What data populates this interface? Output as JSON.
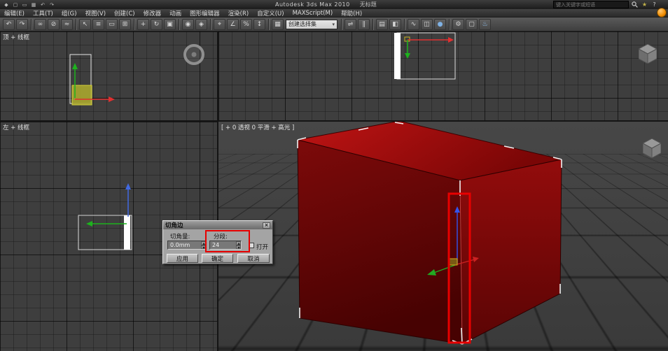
{
  "colors": {
    "box_top": "#bf1414",
    "box_front": "#7d0a0a",
    "box_right": "#930c0c",
    "annotation_red": "#e60000",
    "viewport_bg": "#3e3e3e",
    "infocenter_orb": "#f08c00"
  },
  "titlebar": {
    "app_title": "Autodesk 3ds Max 2010",
    "doc_title": "无标题",
    "search_placeholder": "键入关键字或短语",
    "icons": {
      "star": "★",
      "help": "?"
    },
    "qat": [
      {
        "name": "app-icon",
        "glyph": "◆"
      },
      {
        "name": "new-scene-icon",
        "glyph": "▢"
      },
      {
        "name": "open-file-icon",
        "glyph": "▭"
      },
      {
        "name": "save-file-icon",
        "glyph": "▦"
      },
      {
        "name": "undo-small-icon",
        "glyph": "↶"
      },
      {
        "name": "redo-small-icon",
        "glyph": "↷"
      }
    ]
  },
  "menubar": {
    "items": [
      "编辑(E)",
      "工具(T)",
      "组(G)",
      "视图(V)",
      "创建(C)",
      "修改器",
      "动画",
      "图形编辑器",
      "渲染(R)",
      "自定义(U)",
      "MAXScript(M)",
      "帮助(H)"
    ]
  },
  "toolbar": {
    "items": [
      {
        "type": "icon",
        "name": "undo-icon",
        "glyph": "↶"
      },
      {
        "type": "icon",
        "name": "redo-icon",
        "glyph": "↷"
      },
      {
        "type": "sep"
      },
      {
        "type": "icon",
        "name": "select-link-icon",
        "glyph": "∞"
      },
      {
        "type": "icon",
        "name": "unlink-icon",
        "glyph": "⊘"
      },
      {
        "type": "icon",
        "name": "bind-spacewarp-icon",
        "glyph": "≈"
      },
      {
        "type": "sep"
      },
      {
        "type": "icon",
        "name": "select-object-icon",
        "glyph": "↖"
      },
      {
        "type": "icon",
        "name": "select-by-name-icon",
        "glyph": "≡"
      },
      {
        "type": "icon",
        "name": "rect-region-icon",
        "glyph": "▭"
      },
      {
        "type": "icon",
        "name": "window-crossing-icon",
        "glyph": "⊞"
      },
      {
        "type": "sep"
      },
      {
        "type": "icon",
        "name": "select-move-icon",
        "glyph": "+"
      },
      {
        "type": "icon",
        "name": "select-rotate-icon",
        "glyph": "↻"
      },
      {
        "type": "icon",
        "name": "select-scale-icon",
        "glyph": "▣"
      },
      {
        "type": "sep"
      },
      {
        "type": "icon",
        "name": "use-pivot-icon",
        "glyph": "◉"
      },
      {
        "type": "icon",
        "name": "select-manipulate-icon",
        "glyph": "◈"
      },
      {
        "type": "sep"
      },
      {
        "type": "icon",
        "name": "snap-toggle-icon",
        "glyph": "⌖"
      },
      {
        "type": "icon",
        "name": "angle-snap-icon",
        "glyph": "∠"
      },
      {
        "type": "icon",
        "name": "percent-snap-icon",
        "glyph": "%"
      },
      {
        "type": "icon",
        "name": "spinner-snap-icon",
        "glyph": "↕"
      },
      {
        "type": "sep"
      },
      {
        "type": "icon",
        "name": "edit-named-sets-icon",
        "glyph": "▦"
      },
      {
        "type": "combo",
        "name": "named-selection-sets-combo",
        "label": "创建选择集"
      },
      {
        "type": "sep"
      },
      {
        "type": "icon",
        "name": "mirror-icon",
        "glyph": "⇌"
      },
      {
        "type": "icon",
        "name": "align-icon",
        "glyph": "∥"
      },
      {
        "type": "sep"
      },
      {
        "type": "icon",
        "name": "layer-manager-icon",
        "glyph": "▤"
      },
      {
        "type": "icon",
        "name": "graphite-ribbon-icon",
        "glyph": "◧"
      },
      {
        "type": "sep"
      },
      {
        "type": "icon",
        "name": "curve-editor-icon",
        "glyph": "∿"
      },
      {
        "type": "icon",
        "name": "schematic-view-icon",
        "glyph": "◫"
      },
      {
        "type": "icon",
        "name": "material-editor-icon",
        "glyph": "●",
        "color": "#7fb2e5"
      },
      {
        "type": "sep"
      },
      {
        "type": "icon",
        "name": "render-setup-icon",
        "glyph": "⚙"
      },
      {
        "type": "icon",
        "name": "rendered-frame-icon",
        "glyph": "▢"
      },
      {
        "type": "icon",
        "name": "render-production-icon",
        "glyph": "♨",
        "color": "#8fc0ee"
      }
    ]
  },
  "viewports": {
    "top": {
      "label": "顶 + 线框"
    },
    "left": {
      "label": "左 + 线框"
    },
    "perspective": {
      "label": "[ + 0 透视 0 平滑 + 高光 ]"
    }
  },
  "dialog": {
    "title": "切角边",
    "amount_label": "切角量:",
    "amount_value": "0.0mm",
    "segments_label": "分段:",
    "segments_value": "24",
    "open_label": "打开",
    "apply": "应用",
    "ok": "确定",
    "cancel": "取消"
  }
}
